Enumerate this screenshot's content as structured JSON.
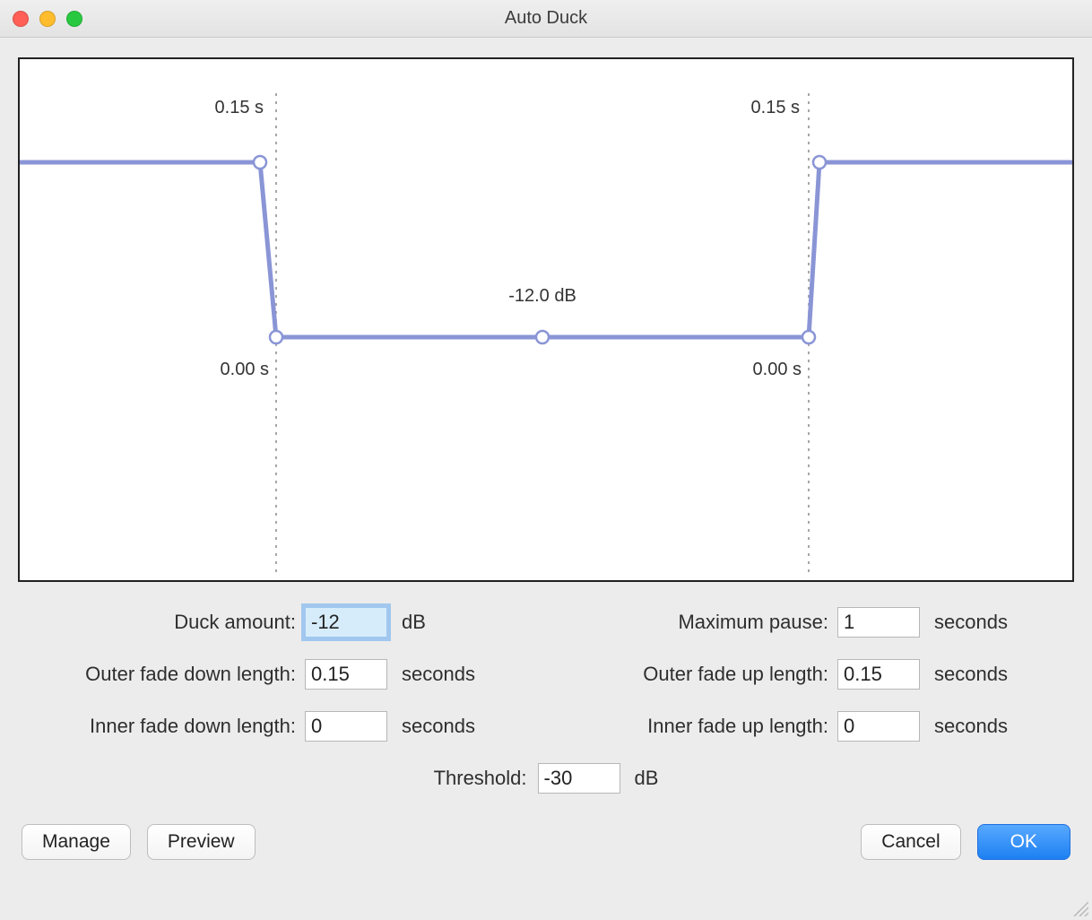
{
  "window": {
    "title": "Auto Duck"
  },
  "chart_data": {
    "type": "line",
    "title": "",
    "annotations": {
      "fade_down_label": "0.15 s",
      "fade_up_label": "0.15 s",
      "inner_down_label": "0.00 s",
      "inner_up_label": "0.00 s",
      "duck_label": "-12.0 dB"
    },
    "envelope": {
      "baseline_db": 0,
      "duck_db": -12.0,
      "outer_fade_down_s": 0.15,
      "inner_fade_down_s": 0.0,
      "inner_fade_up_s": 0.0,
      "outer_fade_up_s": 0.15
    }
  },
  "fields": {
    "duck_amount": {
      "label": "Duck amount:",
      "value": "-12",
      "unit": "dB"
    },
    "max_pause": {
      "label": "Maximum pause:",
      "value": "1",
      "unit": "seconds"
    },
    "outer_fade_down": {
      "label": "Outer fade down length:",
      "value": "0.15",
      "unit": "seconds"
    },
    "outer_fade_up": {
      "label": "Outer fade up length:",
      "value": "0.15",
      "unit": "seconds"
    },
    "inner_fade_down": {
      "label": "Inner fade down length:",
      "value": "0",
      "unit": "seconds"
    },
    "inner_fade_up": {
      "label": "Inner fade up length:",
      "value": "0",
      "unit": "seconds"
    },
    "threshold": {
      "label": "Threshold:",
      "value": "-30",
      "unit": "dB"
    }
  },
  "buttons": {
    "manage": "Manage",
    "preview": "Preview",
    "cancel": "Cancel",
    "ok": "OK"
  }
}
